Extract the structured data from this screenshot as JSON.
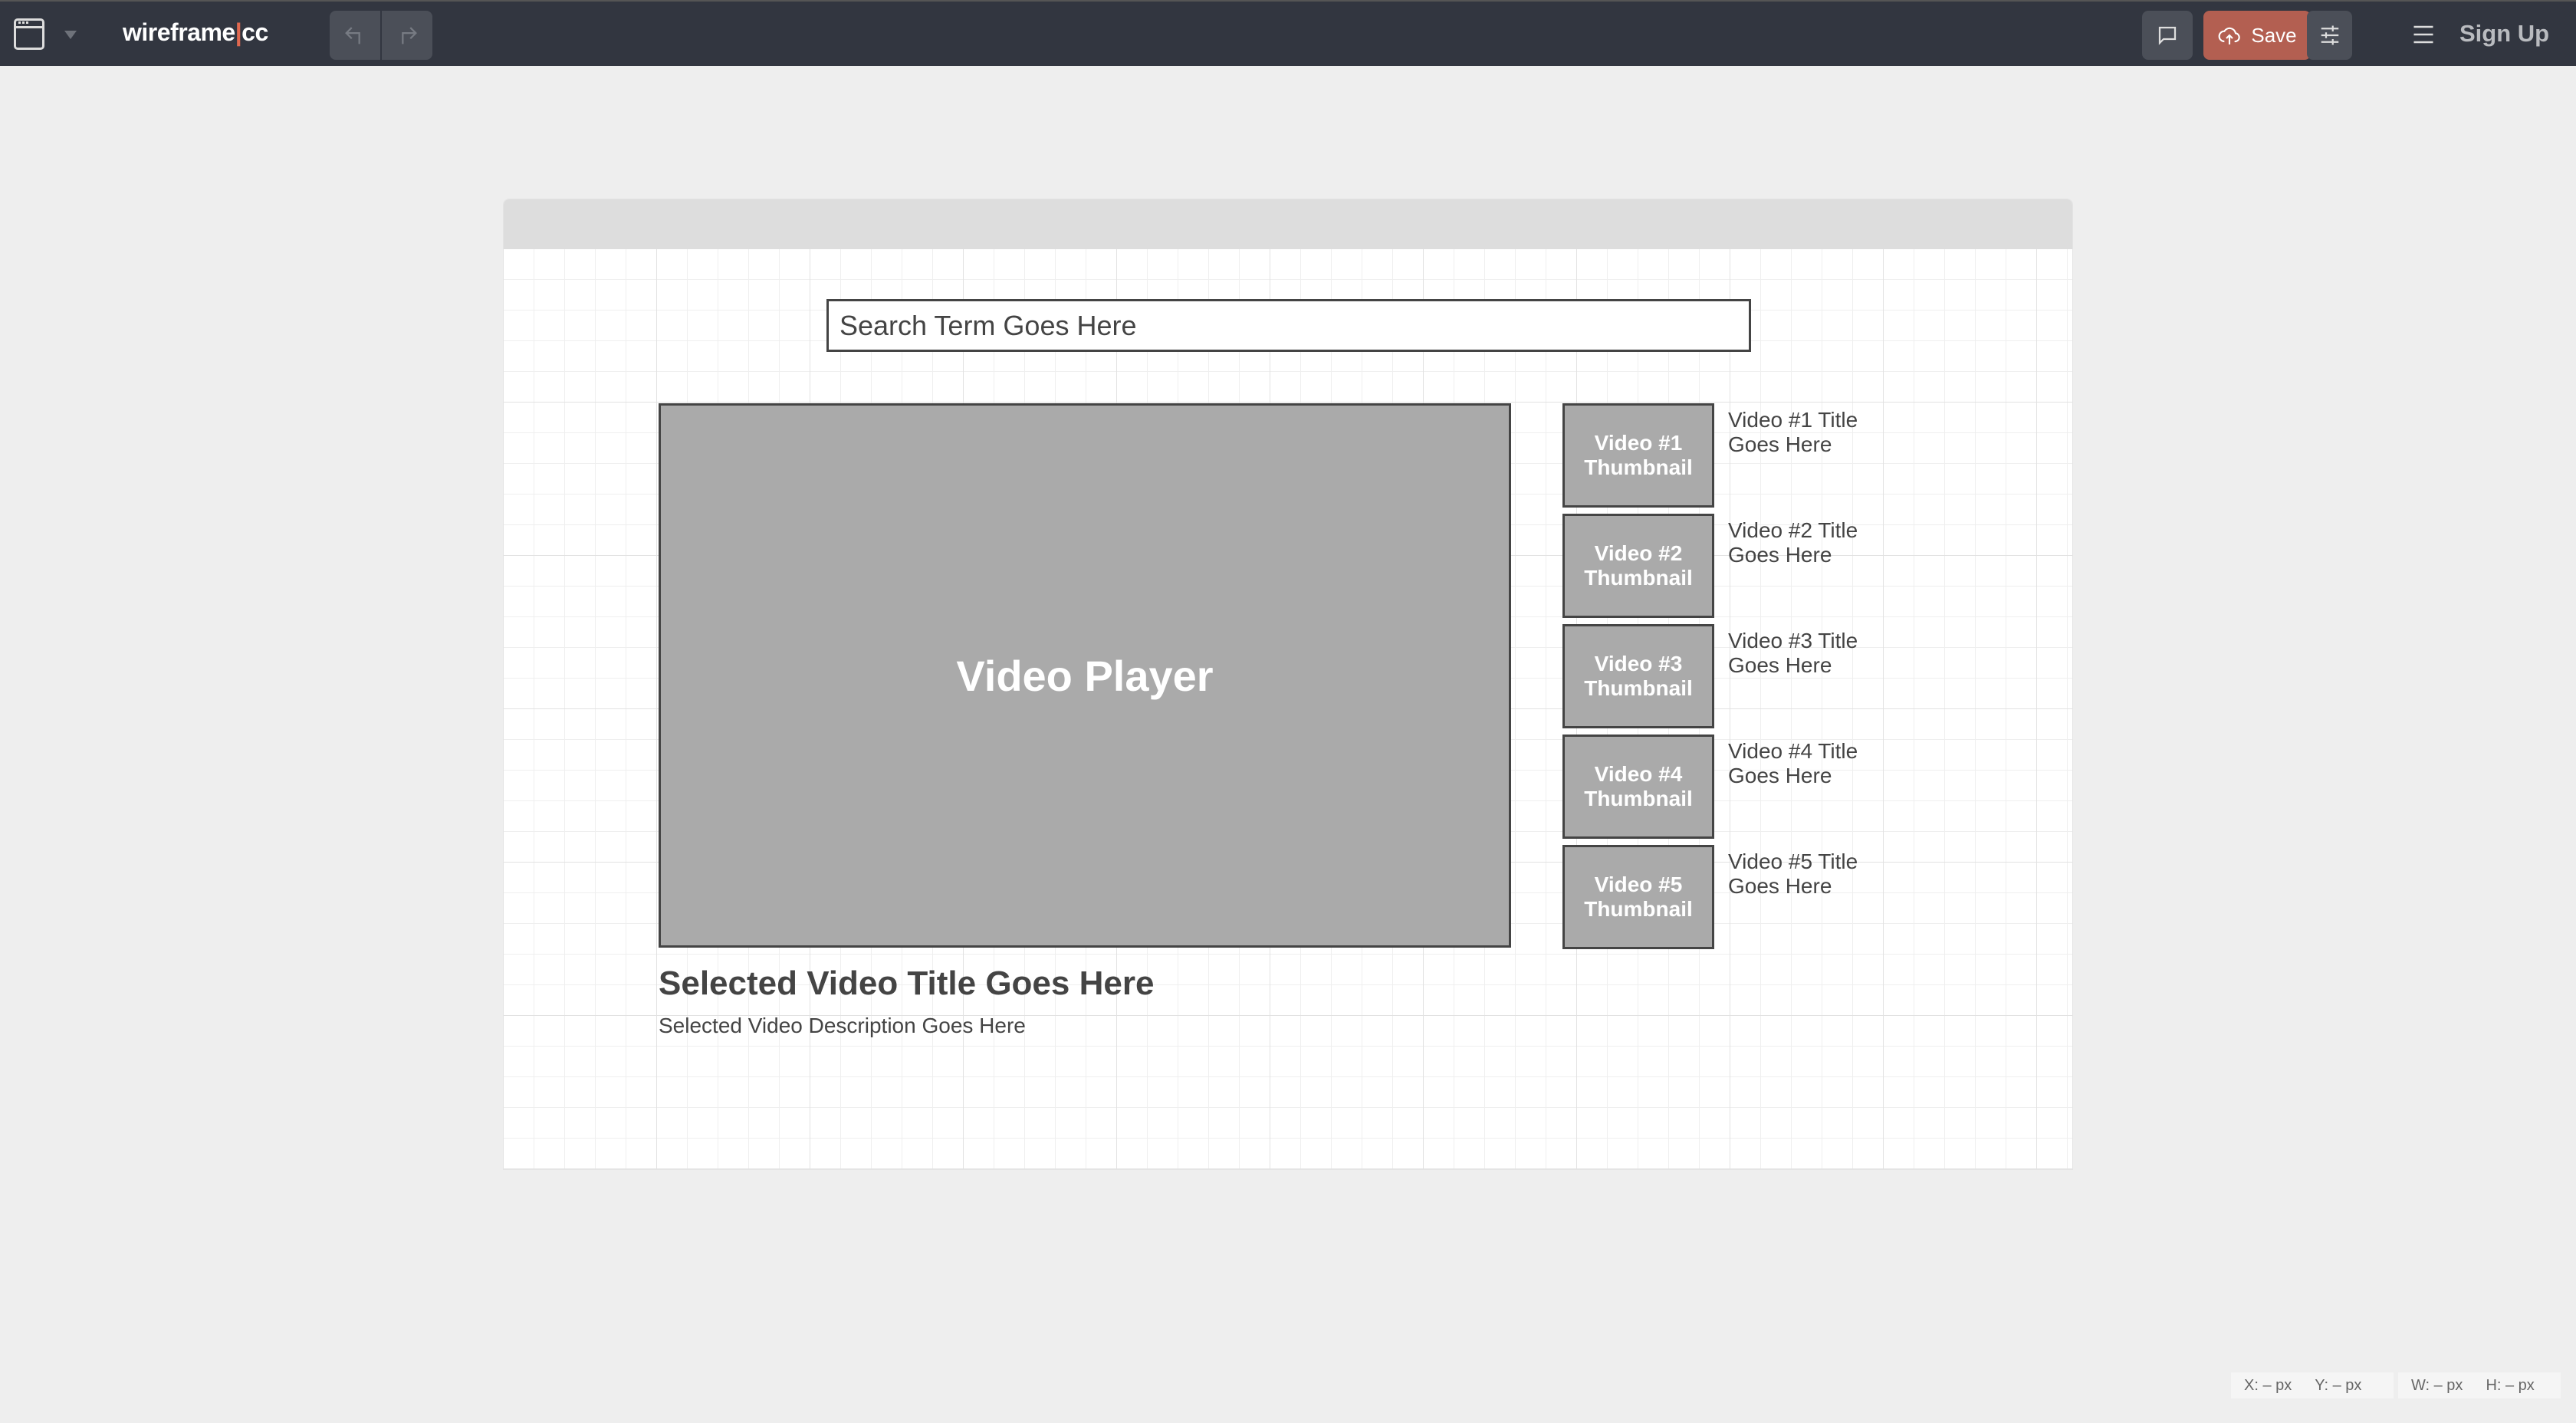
{
  "topbar": {
    "logo_left": "wireframe",
    "logo_sep": "|",
    "logo_right": "cc",
    "save_label": "Save",
    "signup_label": "Sign Up",
    "accent_color": "#b35f51"
  },
  "canvas": {
    "search_text": "Search Term Goes Here",
    "player_label": "Video Player",
    "thumbnails": [
      {
        "label": "Video #1 Thumbnail",
        "title": "Video #1 Title Goes Here"
      },
      {
        "label": "Video #2 Thumbnail",
        "title": "Video #2 Title Goes Here"
      },
      {
        "label": "Video #3 Thumbnail",
        "title": "Video #3 Title Goes Here"
      },
      {
        "label": "Video #4 Thumbnail",
        "title": "Video #4 Title Goes Here"
      },
      {
        "label": "Video #5 Thumbnail",
        "title": "Video #5 Title Goes Here"
      }
    ],
    "selected_title": "Selected Video Title Goes Here",
    "selected_description": "Selected Video Description Goes Here"
  },
  "status": {
    "x": "X: – px",
    "y": "Y: – px",
    "w": "W: – px",
    "h": "H: – px"
  }
}
